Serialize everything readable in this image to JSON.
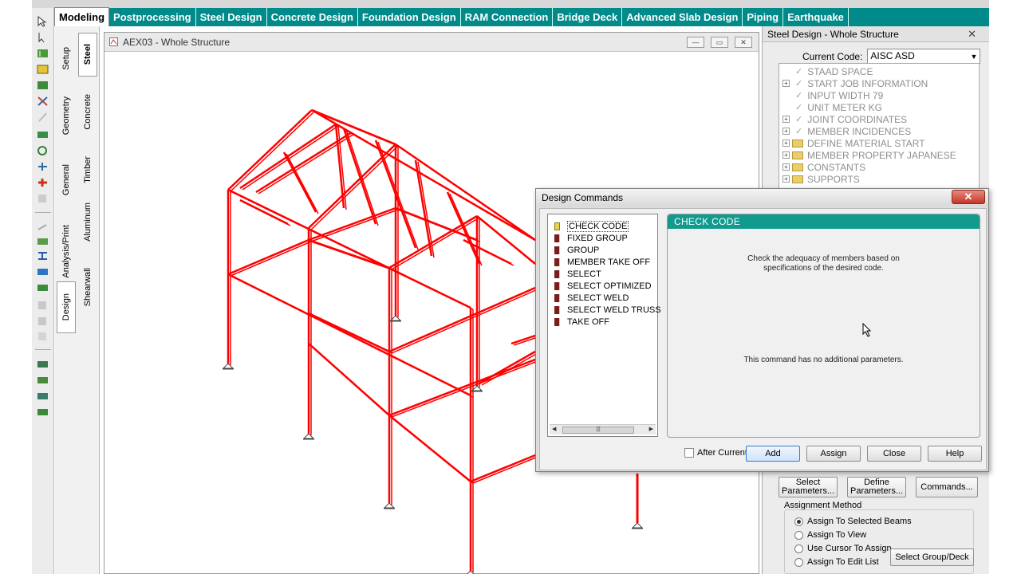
{
  "tabs": [
    "Modeling",
    "Postprocessing",
    "Steel Design",
    "Concrete Design",
    "Foundation Design",
    "RAM Connection",
    "Bridge Deck",
    "Advanced Slab Design",
    "Piping",
    "Earthquake"
  ],
  "active_tab": "Modeling",
  "page_control_outer": [
    "Setup",
    "Geometry",
    "General",
    "Analysis/Print",
    "Design"
  ],
  "page_control_inner": [
    "Steel",
    "Concrete",
    "Timber",
    "Aluminum",
    "Shearwall"
  ],
  "view_window": {
    "title": "AEX03 - Whole Structure",
    "structure_color": "#ff0000"
  },
  "right_panel": {
    "title": "Steel Design - Whole Structure",
    "code_label": "Current Code:",
    "code_value": "AISC ASD",
    "tree": [
      {
        "label": "STAAD SPACE"
      },
      {
        "label": "START JOB INFORMATION"
      },
      {
        "label": "INPUT WIDTH 79"
      },
      {
        "label": "UNIT METER KG"
      },
      {
        "label": "JOINT COORDINATES"
      },
      {
        "label": "MEMBER INCIDENCES"
      },
      {
        "label": "DEFINE MATERIAL START"
      },
      {
        "label": "MEMBER PROPERTY JAPANESE"
      },
      {
        "label": "CONSTANTS"
      },
      {
        "label": "SUPPORTS"
      }
    ],
    "buttons": {
      "select_params": "Select Parameters...",
      "define_params": "Define Parameters...",
      "commands": "Commands..."
    },
    "assignment_method_label": "Assignment Method",
    "assignment_options": [
      "Assign To Selected Beams",
      "Assign To View",
      "Use Cursor To Assign",
      "Assign To Edit List"
    ],
    "selected_option": "Assign To Selected Beams",
    "select_group_btn": "Select Group/Deck"
  },
  "dialog": {
    "title": "Design Commands",
    "close_symbol": "✕",
    "commands": [
      "CHECK CODE",
      "FIXED GROUP",
      "GROUP",
      "MEMBER TAKE OFF",
      "SELECT",
      "SELECT OPTIMIZED",
      "SELECT WELD",
      "SELECT WELD TRUSS",
      "TAKE OFF"
    ],
    "selected_command": "CHECK CODE",
    "panel_header": "CHECK CODE",
    "description_line1": "Check the adequacy of members based on",
    "description_line2": "specifications of the desired code.",
    "note": "This command has no additional parameters.",
    "after_current": "After Current",
    "buttons": {
      "add": "Add",
      "assign": "Assign",
      "close": "Close",
      "help": "Help"
    },
    "accent": "#119b8f"
  }
}
